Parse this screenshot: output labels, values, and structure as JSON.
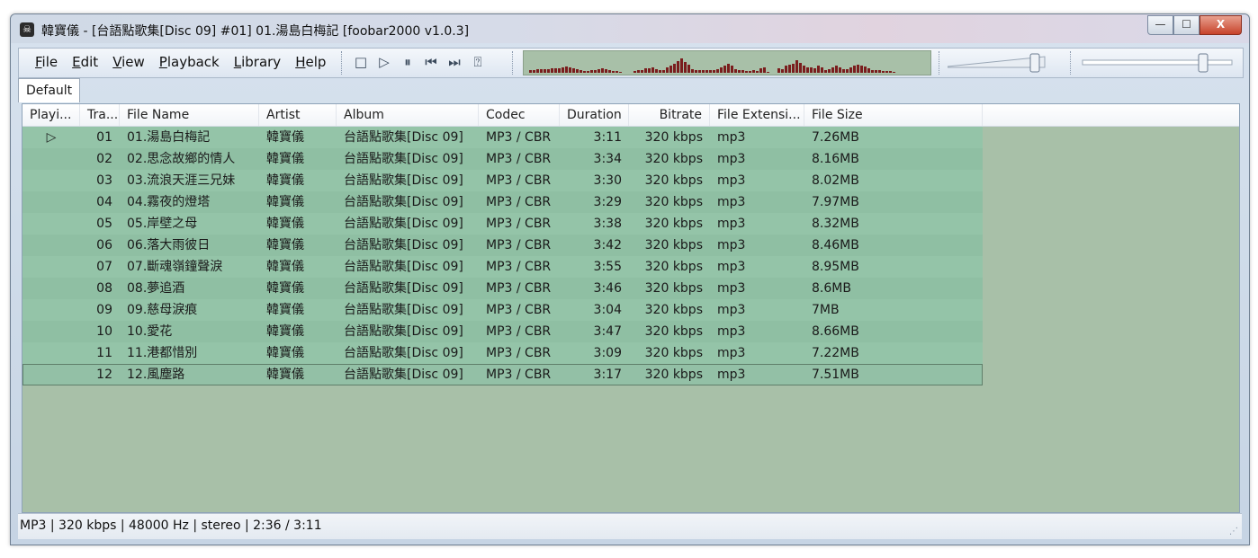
{
  "window": {
    "title": "韓寶儀 - [台語點歌集[Disc 09] #01] 01.湯島白梅記  [foobar2000 v1.0.3]",
    "minimize": "—",
    "maximize": "☐",
    "close": "X"
  },
  "menu": [
    "File",
    "Edit",
    "View",
    "Playback",
    "Library",
    "Help"
  ],
  "transport": [
    "stop-icon",
    "play-icon",
    "pause-icon",
    "previous-icon",
    "next-icon",
    "random-icon"
  ],
  "tab": "Default",
  "columns": [
    "Playi...",
    "Tra...",
    "File Name",
    "Artist",
    "Album",
    "Codec",
    "Duration",
    "Bitrate",
    "File Extensi...",
    "File Size"
  ],
  "tracks": [
    {
      "playing": "▷",
      "track": "01",
      "file": "01.湯島白梅記",
      "artist": "韓寶儀",
      "album": "台語點歌集[Disc 09]",
      "codec": "MP3 / CBR",
      "duration": "3:11",
      "bitrate": "320 kbps",
      "ext": "mp3",
      "size": "7.26MB"
    },
    {
      "playing": "",
      "track": "02",
      "file": "02.思念故鄉的情人",
      "artist": "韓寶儀",
      "album": "台語點歌集[Disc 09]",
      "codec": "MP3 / CBR",
      "duration": "3:34",
      "bitrate": "320 kbps",
      "ext": "mp3",
      "size": "8.16MB"
    },
    {
      "playing": "",
      "track": "03",
      "file": "03.流浪天涯三兄妹",
      "artist": "韓寶儀",
      "album": "台語點歌集[Disc 09]",
      "codec": "MP3 / CBR",
      "duration": "3:30",
      "bitrate": "320 kbps",
      "ext": "mp3",
      "size": "8.02MB"
    },
    {
      "playing": "",
      "track": "04",
      "file": "04.霧夜的燈塔",
      "artist": "韓寶儀",
      "album": "台語點歌集[Disc 09]",
      "codec": "MP3 / CBR",
      "duration": "3:29",
      "bitrate": "320 kbps",
      "ext": "mp3",
      "size": "7.97MB"
    },
    {
      "playing": "",
      "track": "05",
      "file": "05.岸壁之母",
      "artist": "韓寶儀",
      "album": "台語點歌集[Disc 09]",
      "codec": "MP3 / CBR",
      "duration": "3:38",
      "bitrate": "320 kbps",
      "ext": "mp3",
      "size": "8.32MB"
    },
    {
      "playing": "",
      "track": "06",
      "file": "06.落大雨彼日",
      "artist": "韓寶儀",
      "album": "台語點歌集[Disc 09]",
      "codec": "MP3 / CBR",
      "duration": "3:42",
      "bitrate": "320 kbps",
      "ext": "mp3",
      "size": "8.46MB"
    },
    {
      "playing": "",
      "track": "07",
      "file": "07.斷魂嶺鐘聲淚",
      "artist": "韓寶儀",
      "album": "台語點歌集[Disc 09]",
      "codec": "MP3 / CBR",
      "duration": "3:55",
      "bitrate": "320 kbps",
      "ext": "mp3",
      "size": "8.95MB"
    },
    {
      "playing": "",
      "track": "08",
      "file": "08.夢追酒",
      "artist": "韓寶儀",
      "album": "台語點歌集[Disc 09]",
      "codec": "MP3 / CBR",
      "duration": "3:46",
      "bitrate": "320 kbps",
      "ext": "mp3",
      "size": "8.6MB"
    },
    {
      "playing": "",
      "track": "09",
      "file": "09.慈母淚痕",
      "artist": "韓寶儀",
      "album": "台語點歌集[Disc 09]",
      "codec": "MP3 / CBR",
      "duration": "3:04",
      "bitrate": "320 kbps",
      "ext": "mp3",
      "size": "7MB"
    },
    {
      "playing": "",
      "track": "10",
      "file": "10.愛花",
      "artist": "韓寶儀",
      "album": "台語點歌集[Disc 09]",
      "codec": "MP3 / CBR",
      "duration": "3:47",
      "bitrate": "320 kbps",
      "ext": "mp3",
      "size": "8.66MB"
    },
    {
      "playing": "",
      "track": "11",
      "file": "11.港都惜別",
      "artist": "韓寶儀",
      "album": "台語點歌集[Disc 09]",
      "codec": "MP3 / CBR",
      "duration": "3:09",
      "bitrate": "320 kbps",
      "ext": "mp3",
      "size": "7.22MB"
    },
    {
      "playing": "",
      "track": "12",
      "file": "12.風塵路",
      "artist": "韓寶儀",
      "album": "台語點歌集[Disc 09]",
      "codec": "MP3 / CBR",
      "duration": "3:17",
      "bitrate": "320 kbps",
      "ext": "mp3",
      "size": "7.51MB"
    }
  ],
  "status": "MP3 | 320 kbps | 48000 Hz | stereo | 2:36 / 3:11",
  "volume_level": 0.9,
  "seek_position": 0.82,
  "colors": {
    "playlist_bg": "#a8c0a8",
    "row_bg": "#94c4a8",
    "spectrum_bar": "#7a1d1d"
  }
}
